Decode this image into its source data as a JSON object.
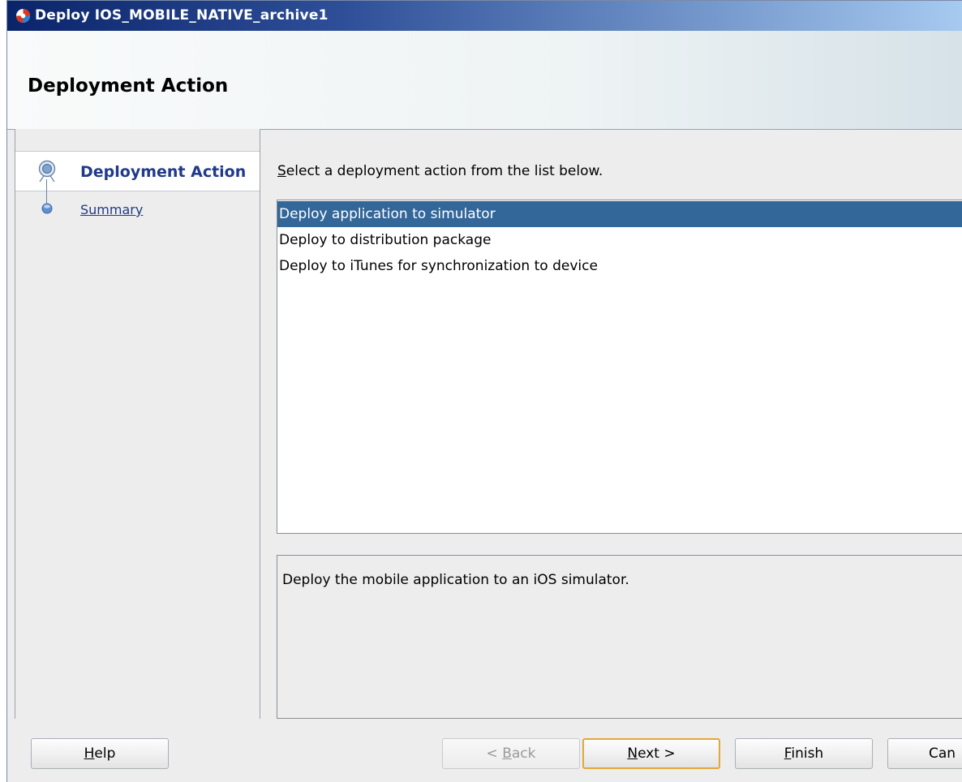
{
  "window": {
    "title": "Deploy IOS_MOBILE_NATIVE_archive1",
    "icon": "oracle-jdeveloper-icon"
  },
  "header": {
    "title": "Deployment Action"
  },
  "nav": {
    "items": [
      {
        "label": "Deployment Action",
        "active": true,
        "icon": "wizard-step-active-icon"
      },
      {
        "label": "Summary",
        "active": false,
        "icon": "wizard-step-dot-icon"
      }
    ]
  },
  "content": {
    "instruction_mnemonic": "S",
    "instruction_rest": "elect a deployment action from the list below.",
    "actions": [
      {
        "label": "Deploy application to simulator",
        "selected": true
      },
      {
        "label": "Deploy to distribution package",
        "selected": false
      },
      {
        "label": "Deploy to iTunes for synchronization to device",
        "selected": false
      }
    ],
    "description": "Deploy the mobile application to an iOS simulator."
  },
  "footer": {
    "help": {
      "mnemonic": "H",
      "rest": "elp"
    },
    "back": {
      "prefix": "< ",
      "mnemonic": "B",
      "rest": "ack",
      "enabled": false
    },
    "next": {
      "mnemonic": "N",
      "rest": "ext >",
      "default": true
    },
    "finish": {
      "mnemonic": "F",
      "rest": "inish"
    },
    "cancel": {
      "label": "Can"
    }
  },
  "colors": {
    "selection": "#336699",
    "title_gradient_start": "#0a246a",
    "link": "#1f3a8a",
    "default_button_border": "#e3a73b"
  }
}
